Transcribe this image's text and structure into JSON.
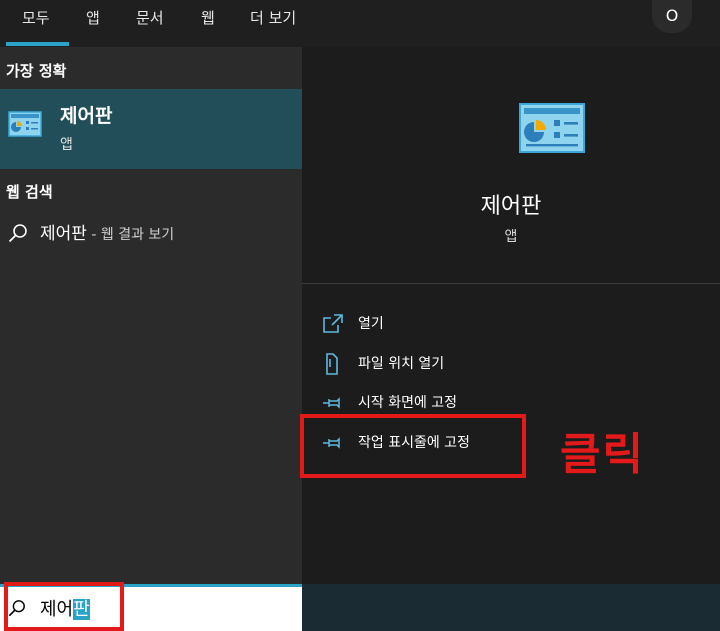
{
  "tabs": [
    {
      "label": "모두"
    },
    {
      "label": "앱"
    },
    {
      "label": "문서"
    },
    {
      "label": "웹"
    },
    {
      "label": "더 보기"
    }
  ],
  "user_button": {
    "label": "O"
  },
  "left": {
    "best_match_title": "가장 정확",
    "best_match": {
      "name": "제어판",
      "type": "앱",
      "icon": "control-panel-icon"
    },
    "web_search_title": "웹 검색",
    "web_result": {
      "term": "제어판",
      "suffix": " - 웹 결과 보기",
      "icon": "search-icon"
    }
  },
  "preview": {
    "name": "제어판",
    "type": "앱",
    "icon": "control-panel-icon"
  },
  "actions": [
    {
      "label": "열기",
      "icon": "open-icon"
    },
    {
      "label": "파일 위치 열기",
      "icon": "file-location-icon"
    },
    {
      "label": "시작 화면에 고정",
      "icon": "pin-icon"
    },
    {
      "label": "작업 표시줄에 고정",
      "icon": "pin-icon"
    }
  ],
  "search": {
    "typed": "제어",
    "selected": "판",
    "icon": "search-icon"
  },
  "annotation": {
    "click_label": "클릭",
    "color": "#e3191a"
  },
  "colors": {
    "accent": "#2aa3c9",
    "selected_bg": "#224e59"
  }
}
